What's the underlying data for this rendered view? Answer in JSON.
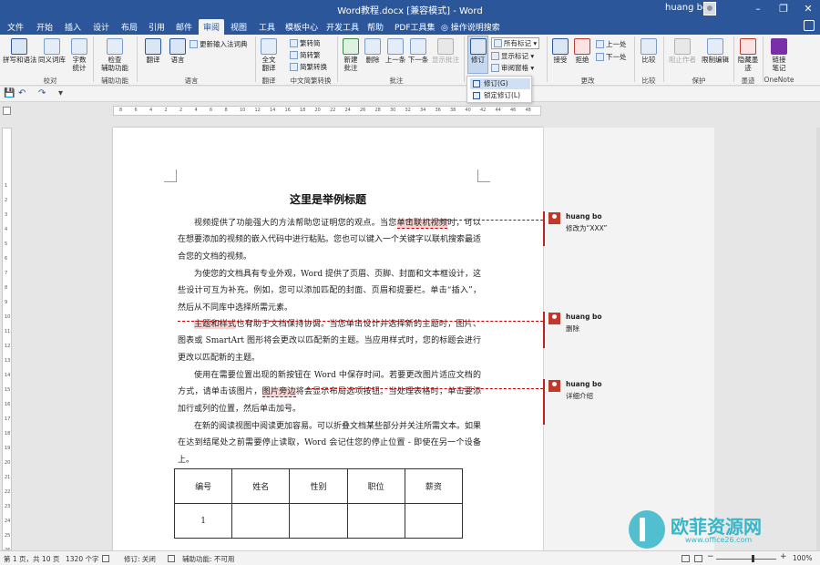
{
  "titlebar": {
    "title": "Word教程.docx [兼容模式] - Word",
    "user": "huang bo",
    "minimize": "–",
    "restore": "❐",
    "close": "✕"
  },
  "tabs": [
    "文件",
    "开始",
    "插入",
    "设计",
    "布局",
    "引用",
    "邮件",
    "审阅",
    "视图",
    "工具",
    "模板中心",
    "开发工具",
    "帮助",
    "PDF工具集"
  ],
  "active_tab": "审阅",
  "tell_me": "操作说明搜索",
  "ribbon": {
    "spell": "拼写和语法",
    "thesaurus": "同义词库",
    "wordcount_1": "字数",
    "wordcount_2": "统计",
    "wordcount_icon": "ABC\n123",
    "check_1": "检查",
    "check_2": "辅助功能",
    "translate": "翻译",
    "language": "语言",
    "update_ime": "更新输入法词典",
    "fullwidth_1": "全文",
    "fullwidth_2": "翻译",
    "to_trad": "繁转简",
    "to_simp": "简转繁",
    "simp_trad": "简繁转换",
    "new_comment_1": "新建",
    "new_comment_2": "批注",
    "delete": "删除",
    "prev": "上一条",
    "next": "下一条",
    "show_comments": "显示批注",
    "track": "修订",
    "all_markup": "所有标记",
    "show_markup": "显示标记",
    "review_pane": "审阅窗格",
    "accept": "接受",
    "reject": "拒绝",
    "prev_change": "上一处",
    "next_change": "下一处",
    "compare": "比较",
    "block_authors": "阻止作者",
    "restrict": "限制编辑",
    "hide_ink_1": "隐藏墨",
    "hide_ink_2": "迹",
    "linked_1": "链接",
    "linked_2": "笔记"
  },
  "groups": {
    "proofing": "校对",
    "accessibility": "辅助功能",
    "language": "语言",
    "translate": "翻译",
    "chinese": "中文简繁转换",
    "comments": "批注",
    "changes": "更改",
    "compare": "比较",
    "protect": "保护",
    "ink": "墨迹",
    "onenote": "OneNote"
  },
  "dropdown": {
    "item1": "修订(G)",
    "item2": "锁定修订(L)"
  },
  "qat": {
    "save": "💾",
    "undo": "↶",
    "redo": "↷",
    "more": "▾"
  },
  "doc": {
    "title": "这里是举例标题",
    "p1_a": "视频提供了功能强大的方法帮助您证明您的观点。当您",
    "p1_cmt": "单击联机视频",
    "p1_b": "时，可以在想要添加的视频的嵌入代码中进行粘贴。您也可以键入一个关键字以联机搜索最适合您的文档的视频。",
    "p2": "为使您的文档具有专业外观，Word 提供了页眉、页脚、封面和文本框设计，这些设计可互为补充。例如，您可以添加匹配的封面、页眉和提要栏。单击“插入”，然后从不同库中选择所需元素。",
    "p3_del": "主题和样式",
    "p3_b": "也有助于文档保持协调。当您单击设计并选择新的主题时，图片、图表或 SmartArt 图形将会更改以匹配新的主题。当应用样式时，您的标题会进行更改以匹配新的主题。",
    "p4_a": "使用在需要位置出现的新按钮在 Word 中保存时间。若要更改图片适应文档的方式，请单击该图片，",
    "p4_cmt": "图片旁边",
    "p4_b": "将会显示布局选项按钮。当处理表格时，单击要添加行或列的位置，然后单击加号。",
    "p5": "在新的阅读视图中阅读更加容易。可以折叠文档某些部分并关注所需文本。如果在达到结尾处之前需要停止读取，Word 会记住您的停止位置 - 即使在另一个设备上。"
  },
  "comments": [
    {
      "author": "huang bo",
      "text": "修改为“XXX”"
    },
    {
      "author": "huang bo",
      "text": "删除"
    },
    {
      "author": "huang bo",
      "text": "详细介绍"
    }
  ],
  "table": {
    "headers": [
      "编号",
      "姓名",
      "性别",
      "职位",
      "薪资"
    ],
    "row1": [
      "1",
      "",
      "",
      "",
      ""
    ],
    "row2": [
      "",
      "",
      "",
      "",
      ""
    ]
  },
  "status": {
    "page": "第 1 页，共 10 页",
    "words": "1320 个字",
    "track": "修订: 关闭",
    "access": "辅助功能: 不可用",
    "zoom": "100%",
    "minus": "−",
    "plus": "+"
  },
  "watermark": {
    "name": "欧菲资源网",
    "url": "www.office26.com"
  },
  "ruler_ticks": [
    "8",
    "6",
    "4",
    "2",
    "2",
    "4",
    "6",
    "8",
    "10",
    "12",
    "14",
    "16",
    "18",
    "20",
    "22",
    "24",
    "26",
    "28",
    "30",
    "32",
    "34",
    "36",
    "38",
    "40",
    "42",
    "44",
    "46",
    "48"
  ],
  "vruler_ticks": [
    "1",
    "2",
    "3",
    "4",
    "5",
    "6",
    "7",
    "8",
    "9",
    "10",
    "11",
    "12",
    "13",
    "14",
    "15",
    "16",
    "17",
    "18",
    "19",
    "20",
    "21",
    "22",
    "23",
    "24",
    "25",
    "26"
  ]
}
